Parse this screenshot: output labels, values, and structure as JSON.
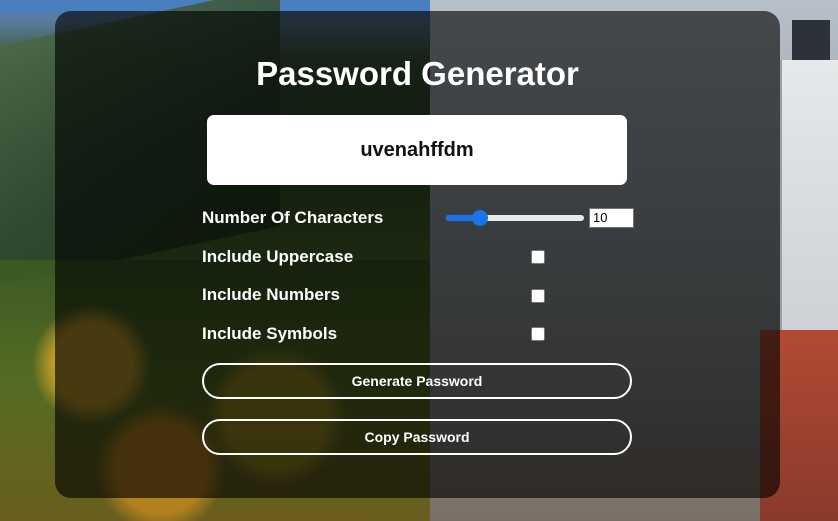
{
  "app": {
    "title": "Password Generator"
  },
  "output": {
    "password": "uvenahffdm"
  },
  "options": {
    "length_label": "Number Of Characters",
    "length_value": "10",
    "length_min": 4,
    "length_max": 32,
    "uppercase_label": "Include Uppercase",
    "uppercase_checked": false,
    "numbers_label": "Include Numbers",
    "numbers_checked": false,
    "symbols_label": "Include Symbols",
    "symbols_checked": false
  },
  "buttons": {
    "generate_label": "Generate Password",
    "copy_label": "Copy Password"
  },
  "colors": {
    "accent": "#1a73e8",
    "panel_overlay": "rgba(0,0,0,0.62)",
    "text": "#ffffff"
  }
}
